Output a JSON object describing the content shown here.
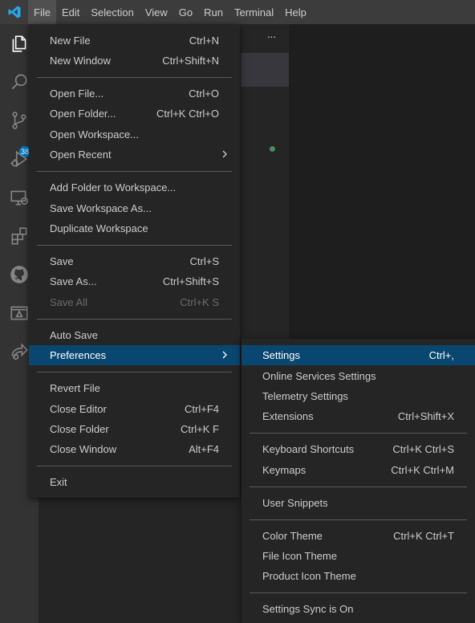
{
  "menubar": {
    "items": [
      "File",
      "Edit",
      "Selection",
      "View",
      "Go",
      "Run",
      "Terminal",
      "Help"
    ]
  },
  "activitybar": {
    "icons": [
      "explorer-icon",
      "search-icon",
      "source-control-icon",
      "run-debug-icon",
      "remote-explorer-icon",
      "extensions-icon",
      "github-icon",
      "azure-icon",
      "live-share-icon"
    ],
    "scm_badge": "38"
  },
  "sidebar": {
    "more_label": "···"
  },
  "file_menu": {
    "items": [
      {
        "label": "New File",
        "shortcut": "Ctrl+N"
      },
      {
        "label": "New Window",
        "shortcut": "Ctrl+Shift+N"
      },
      {
        "label": "Open File...",
        "shortcut": "Ctrl+O"
      },
      {
        "label": "Open Folder...",
        "shortcut": "Ctrl+K Ctrl+O"
      },
      {
        "label": "Open Workspace...",
        "shortcut": ""
      },
      {
        "label": "Open Recent",
        "shortcut": ""
      },
      {
        "label": "Add Folder to Workspace...",
        "shortcut": ""
      },
      {
        "label": "Save Workspace As...",
        "shortcut": ""
      },
      {
        "label": "Duplicate Workspace",
        "shortcut": ""
      },
      {
        "label": "Save",
        "shortcut": "Ctrl+S"
      },
      {
        "label": "Save As...",
        "shortcut": "Ctrl+Shift+S"
      },
      {
        "label": "Save All",
        "shortcut": "Ctrl+K S"
      },
      {
        "label": "Auto Save",
        "shortcut": ""
      },
      {
        "label": "Preferences",
        "shortcut": ""
      },
      {
        "label": "Revert File",
        "shortcut": ""
      },
      {
        "label": "Close Editor",
        "shortcut": "Ctrl+F4"
      },
      {
        "label": "Close Folder",
        "shortcut": "Ctrl+K F"
      },
      {
        "label": "Close Window",
        "shortcut": "Alt+F4"
      },
      {
        "label": "Exit",
        "shortcut": ""
      }
    ]
  },
  "preferences_menu": {
    "items": [
      {
        "label": "Settings",
        "shortcut": "Ctrl+,"
      },
      {
        "label": "Online Services Settings",
        "shortcut": ""
      },
      {
        "label": "Telemetry Settings",
        "shortcut": ""
      },
      {
        "label": "Extensions",
        "shortcut": "Ctrl+Shift+X"
      },
      {
        "label": "Keyboard Shortcuts",
        "shortcut": "Ctrl+K Ctrl+S"
      },
      {
        "label": "Keymaps",
        "shortcut": "Ctrl+K Ctrl+M"
      },
      {
        "label": "User Snippets",
        "shortcut": ""
      },
      {
        "label": "Color Theme",
        "shortcut": "Ctrl+K Ctrl+T"
      },
      {
        "label": "File Icon Theme",
        "shortcut": ""
      },
      {
        "label": "Product Icon Theme",
        "shortcut": ""
      },
      {
        "label": "Settings Sync is On",
        "shortcut": ""
      }
    ]
  },
  "colors": {
    "selection": "#094771",
    "badge": "#007acc",
    "logo": "#23a9f2"
  }
}
